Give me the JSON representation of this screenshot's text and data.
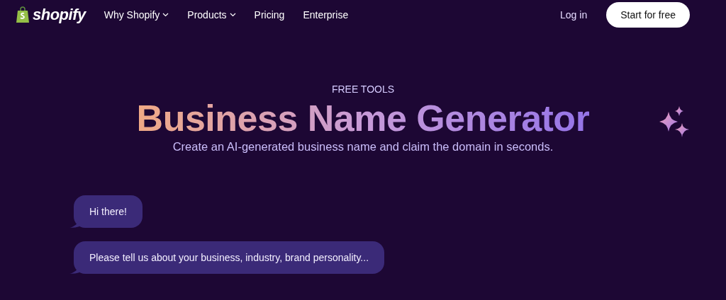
{
  "nav": {
    "logo": "shopify",
    "items": [
      {
        "label": "Why Shopify",
        "dropdown": true
      },
      {
        "label": "Products",
        "dropdown": true
      },
      {
        "label": "Pricing",
        "dropdown": false
      },
      {
        "label": "Enterprise",
        "dropdown": false
      }
    ],
    "login": "Log in",
    "cta": "Start for free"
  },
  "hero": {
    "eyebrow": "FREE TOOLS",
    "title": "Business Name Generator",
    "subtitle": "Create an AI-generated business name and claim the domain in seconds."
  },
  "chat": [
    {
      "text": "Hi there!"
    },
    {
      "text": "Please tell us about your business, industry, brand personality..."
    }
  ]
}
